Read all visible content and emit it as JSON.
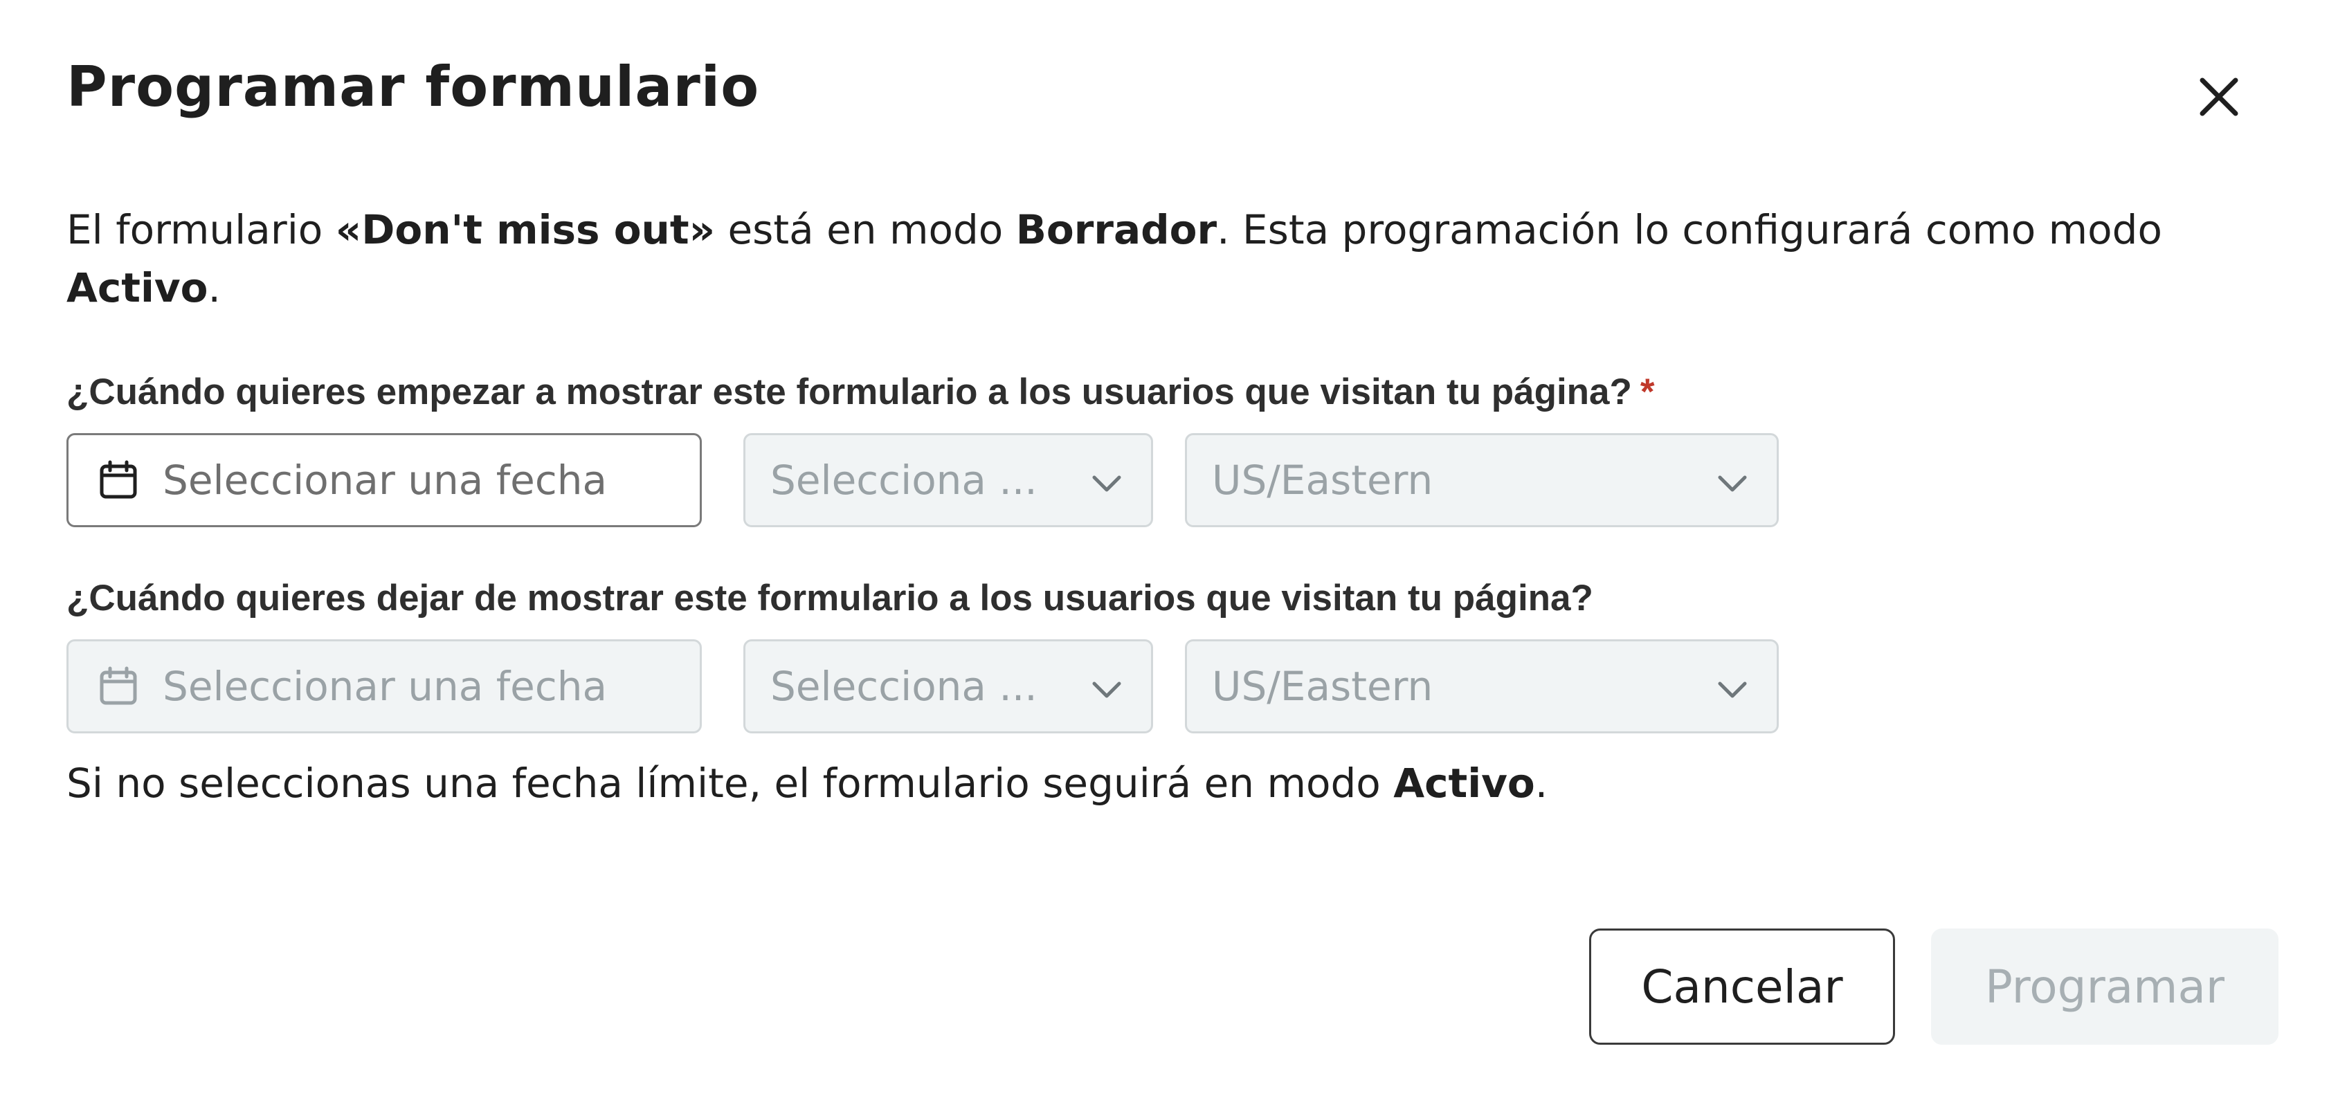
{
  "dialog": {
    "title": "Programar formulario",
    "close_icon": "close-icon"
  },
  "intro": {
    "part1": "El formulario ",
    "form_name": "«Don't miss out»",
    "part2": " está en modo ",
    "current_mode": "Borrador",
    "part3": ". Esta programación lo configurará como modo ",
    "target_mode": "Activo",
    "part4": "."
  },
  "start": {
    "label": "¿Cuándo quieres empezar a mostrar este formulario a los usuarios que visitan tu página?",
    "required_mark": "*",
    "date_placeholder": "Seleccionar una fecha",
    "time_placeholder": "Selecciona ...",
    "timezone": "US/Eastern"
  },
  "end": {
    "label": "¿Cuándo quieres dejar de mostrar este formulario a los usuarios que visitan tu página?",
    "date_placeholder": "Seleccionar una fecha",
    "time_placeholder": "Selecciona ...",
    "timezone": "US/Eastern"
  },
  "hint": {
    "part1": "Si no seleccionas una fecha límite, el formulario seguirá en modo ",
    "mode": "Activo",
    "part2": "."
  },
  "footer": {
    "cancel_label": "Cancelar",
    "schedule_label": "Programar"
  },
  "colors": {
    "required": "#c0392b",
    "disabled_bg": "#f1f4f5",
    "disabled_text": "#9aa2a6"
  }
}
